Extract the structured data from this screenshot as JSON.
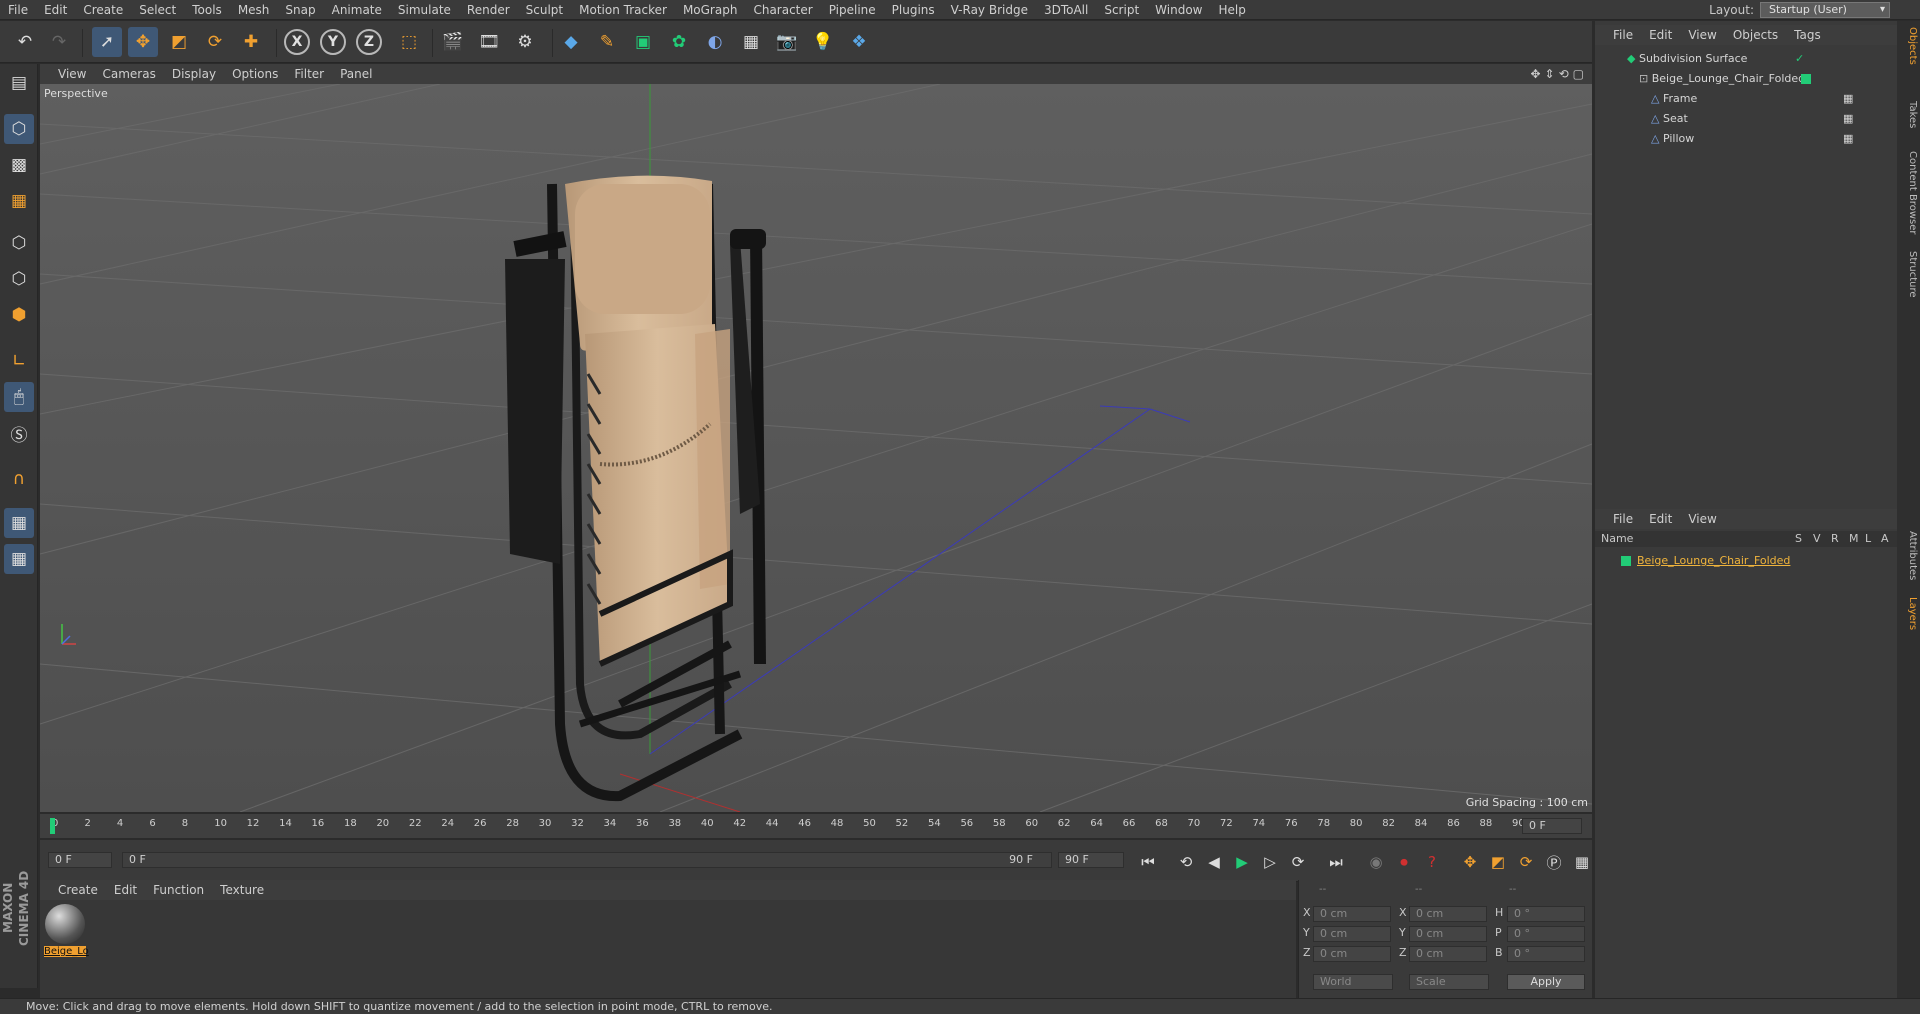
{
  "menubar": {
    "items": [
      "File",
      "Edit",
      "Create",
      "Select",
      "Tools",
      "Mesh",
      "Snap",
      "Animate",
      "Simulate",
      "Render",
      "Sculpt",
      "Motion Tracker",
      "MoGraph",
      "Character",
      "Pipeline",
      "Plugins",
      "V-Ray Bridge",
      "3DToAll",
      "Script",
      "Window",
      "Help"
    ],
    "layout_label": "Layout:",
    "layout_value": "Startup (User)"
  },
  "viewport": {
    "menu": [
      "View",
      "Cameras",
      "Display",
      "Options",
      "Filter",
      "Panel"
    ],
    "label": "Perspective",
    "grid_spacing": "Grid Spacing : 100 cm"
  },
  "timeline": {
    "ticks": [
      "0",
      "2",
      "4",
      "6",
      "8",
      "10",
      "12",
      "14",
      "16",
      "18",
      "20",
      "22",
      "24",
      "26",
      "28",
      "30",
      "32",
      "34",
      "36",
      "38",
      "40",
      "42",
      "44",
      "46",
      "48",
      "50",
      "52",
      "54",
      "56",
      "58",
      "60",
      "62",
      "64",
      "66",
      "68",
      "70",
      "72",
      "74",
      "76",
      "78",
      "80",
      "82",
      "84",
      "86",
      "88",
      "90"
    ],
    "current_frame_right": "0 F",
    "start_field": "0 F",
    "range_start": "0 F",
    "range_end": "90 F",
    "end_field": "90 F"
  },
  "materials": {
    "menu": [
      "Create",
      "Edit",
      "Function",
      "Texture"
    ],
    "items": [
      {
        "label": "Beige_Lo"
      }
    ]
  },
  "attributes": {
    "header": [
      "--",
      "--",
      "--"
    ],
    "rows": [
      {
        "a": "X",
        "av": "0 cm",
        "b": "X",
        "bv": "0 cm",
        "c": "H",
        "cv": "0 °"
      },
      {
        "a": "Y",
        "av": "0 cm",
        "b": "Y",
        "bv": "0 cm",
        "c": "P",
        "cv": "0 °"
      },
      {
        "a": "Z",
        "av": "0 cm",
        "b": "Z",
        "bv": "0 cm",
        "c": "B",
        "cv": "0 °"
      }
    ],
    "coord_mode": "World",
    "size_mode": "Scale",
    "apply_label": "Apply"
  },
  "objects": {
    "menu": [
      "File",
      "Edit",
      "View",
      "Objects",
      "Tags"
    ],
    "tree": [
      {
        "name": "Subdivision Surface",
        "indent": 0
      },
      {
        "name": "Beige_Lounge_Chair_Folded",
        "indent": 1
      },
      {
        "name": "Frame",
        "indent": 2
      },
      {
        "name": "Seat",
        "indent": 2
      },
      {
        "name": "Pillow",
        "indent": 2
      }
    ]
  },
  "layers": {
    "menu": [
      "File",
      "Edit",
      "View"
    ],
    "columns": {
      "name": "Name",
      "flags": [
        "S",
        "V",
        "R",
        "M",
        "L",
        "A"
      ]
    },
    "items": [
      {
        "name": "Beige_Lounge_Chair_Folded"
      }
    ]
  },
  "side_tabs": [
    "Objects",
    "Takes",
    "Content Browser",
    "Structure",
    "Attributes",
    "Layers"
  ],
  "branding": "MAXON CINEMA 4D",
  "status": "Move: Click and drag to move elements. Hold down SHIFT to quantize movement / add to the selection in point mode, CTRL to remove.",
  "colors": {
    "accent": "#f0a030",
    "green": "#22cc77",
    "selected_text": "#f0b43c"
  }
}
